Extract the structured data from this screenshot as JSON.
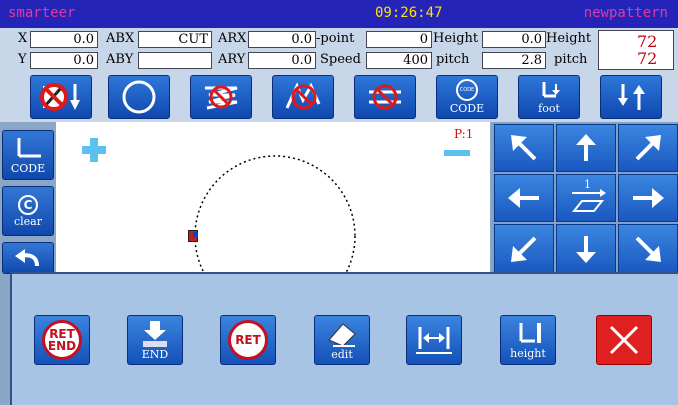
{
  "title_bar": {
    "app_name": "smarteer",
    "clock": "09:26:47",
    "pattern_name": "newpattern"
  },
  "params": {
    "x_label": "X",
    "x_value": "0.0",
    "y_label": "Y",
    "y_value": "0.0",
    "abx_label": "ABX",
    "abx_value": "CUT",
    "aby_label": "ABY",
    "aby_value": "",
    "arx_label": "ARX",
    "arx_value": "0.0",
    "ary_label": "ARY",
    "ary_value": "0.0",
    "point_label": "-point",
    "point_value": "0",
    "speed_label": "Speed",
    "speed_value": "400",
    "height_label_1": "Height",
    "height_value_1": "0.0",
    "pitch_label_1": "pitch",
    "pitch_value_1": "2.8",
    "height_label_2": "Height",
    "pitch_label_2": "pitch",
    "height_value_2": "72",
    "pitch_value_2": "72"
  },
  "toolbar": {
    "code_label": "CODE",
    "code_small": "CODE",
    "foot_label": "foot"
  },
  "left_column": {
    "code_label": "CODE",
    "clear_label": "clear"
  },
  "canvas": {
    "page_indicator": "P:1"
  },
  "dpad": {
    "center_number": "1"
  },
  "bottom_panel": {
    "ret_end_top": "RET",
    "ret_end_bottom": "END",
    "end_label": "END",
    "ret_label": "RET",
    "edit_label": "edit",
    "height_label": "height"
  },
  "colors": {
    "title_bg": "#2424b8",
    "accent_blue": "#1a58c0",
    "close_red": "#e02020"
  }
}
